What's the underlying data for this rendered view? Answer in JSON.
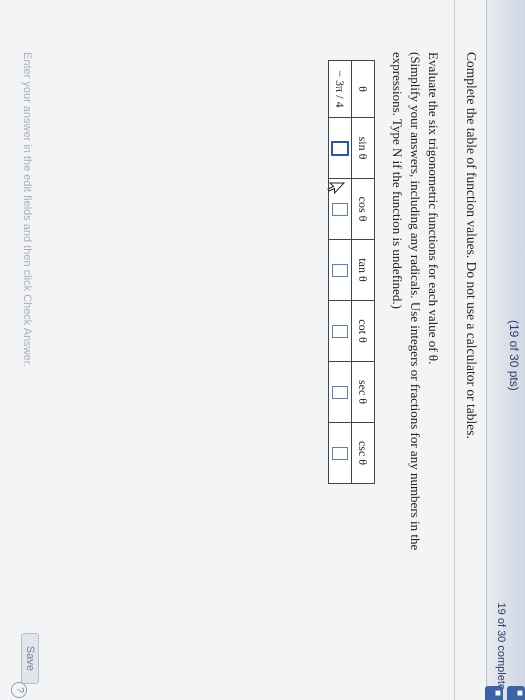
{
  "header": {
    "score": "(19 of 30 pts)",
    "progress": "19 of 30 complete"
  },
  "question": {
    "instruction": "Complete the table of function values. Do not use a calculator or tables.",
    "prompt_lines": [
      "Evaluate the six trigonometric functions for each value of θ.",
      "(Simplify your answers, including any radicals. Use integers or fractions for any numbers in the",
      "expressions. Type N if the function is undefined.)"
    ]
  },
  "table": {
    "headers": [
      "θ",
      "sin θ",
      "cos θ",
      "tan θ",
      "cot θ",
      "sec θ",
      "csc θ"
    ],
    "rows": [
      {
        "theta": "− 3π / 4",
        "answers": [
          "",
          "",
          "",
          "",
          "",
          ""
        ]
      }
    ]
  },
  "footer": {
    "hint": "Enter your answer in the edit fields and then click Check Answer.",
    "save_label": "Save",
    "help_label": "?"
  }
}
